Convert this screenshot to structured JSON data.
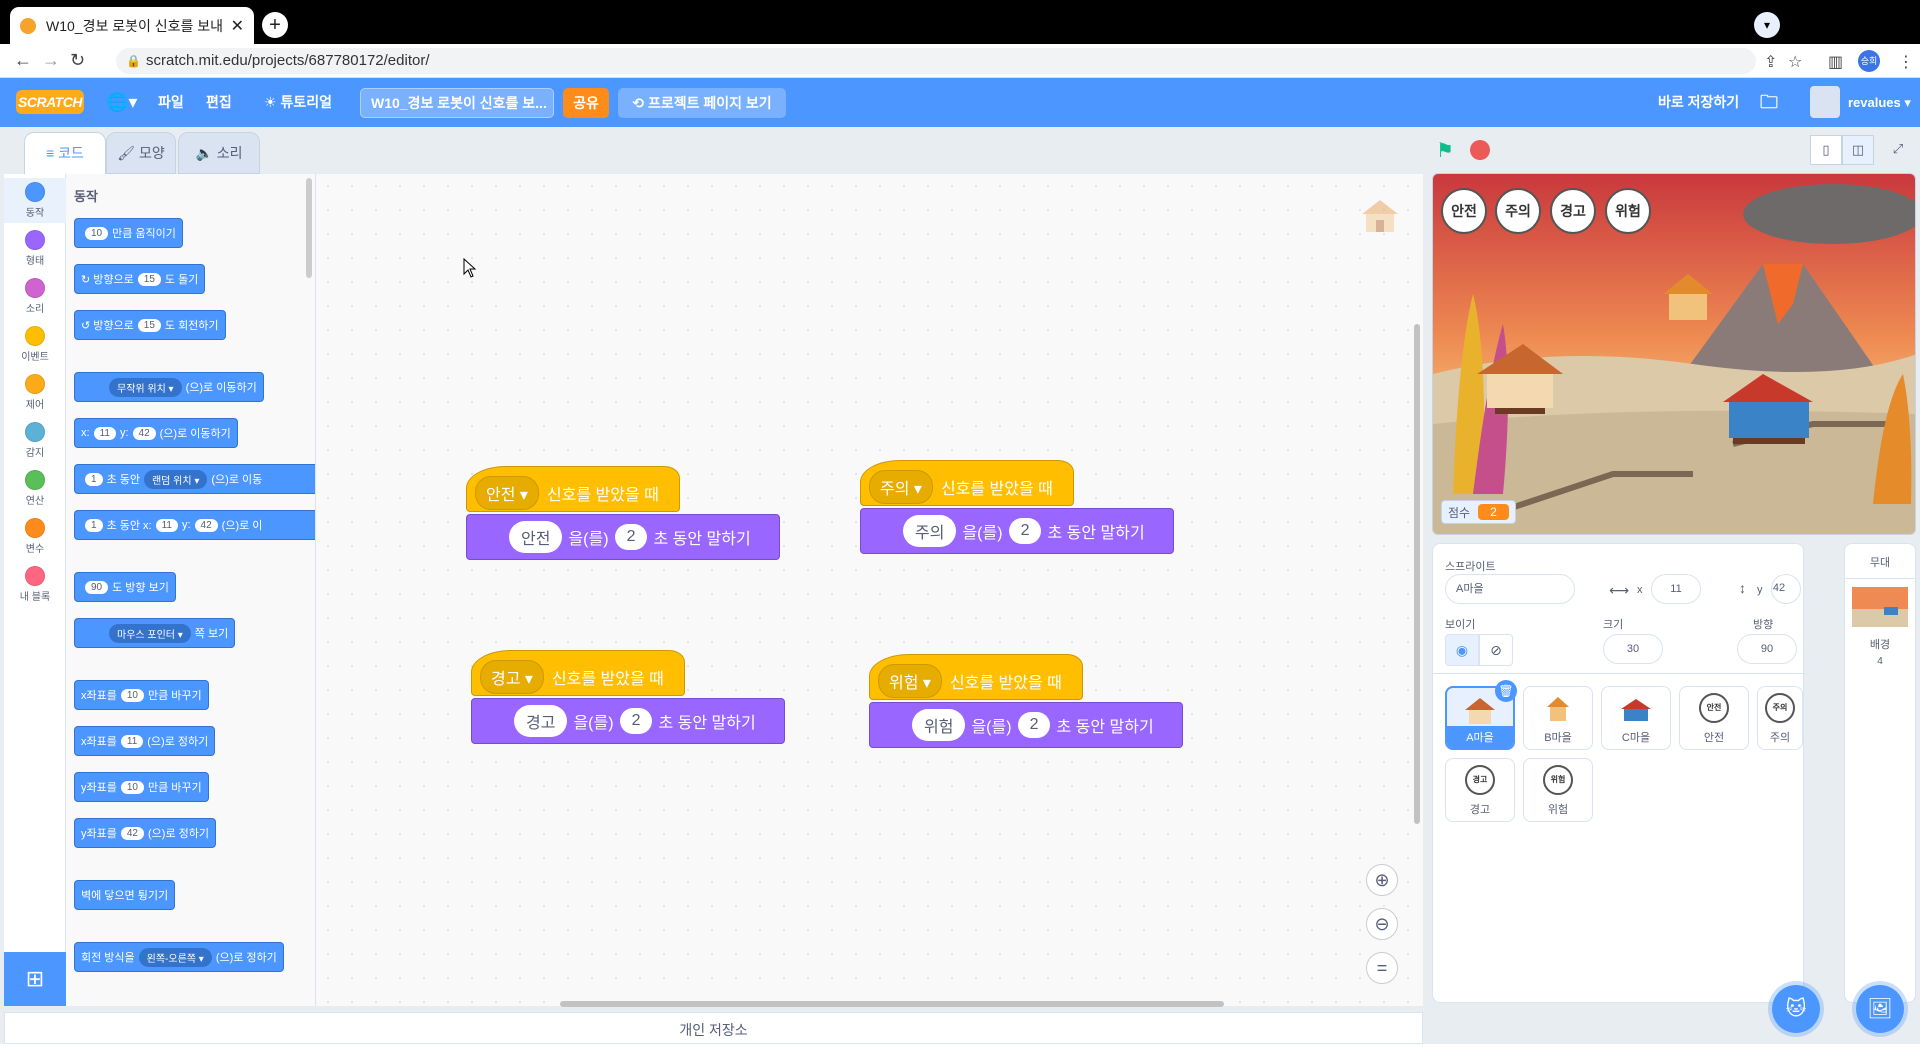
{
  "browser": {
    "tab_title": "W10_경보 로봇이 신호를 보내",
    "url": "scratch.mit.edu/projects/687780172/editor/",
    "avatar_initials": "승희"
  },
  "menu": {
    "logo": "SCRATCH",
    "file": "파일",
    "edit": "편집",
    "tutorials": "튜토리얼",
    "project_title": "W10_경보 로봇이 신호를 보...",
    "share": "공유",
    "see_project": "프로젝트 페이지 보기",
    "save_now": "바로 저장하기",
    "username": "revalues"
  },
  "editor_tabs": {
    "code": "코드",
    "costumes": "모양",
    "sounds": "소리"
  },
  "categories": [
    {
      "label": "동작",
      "color": "#4c97ff"
    },
    {
      "label": "형태",
      "color": "#9966ff"
    },
    {
      "label": "소리",
      "color": "#cf63cf"
    },
    {
      "label": "이벤트",
      "color": "#ffbf00"
    },
    {
      "label": "제어",
      "color": "#ffab19"
    },
    {
      "label": "감지",
      "color": "#5cb1d6"
    },
    {
      "label": "연산",
      "color": "#59c059"
    },
    {
      "label": "변수",
      "color": "#ff8c1a"
    },
    {
      "label": "내 블록",
      "color": "#ff6680"
    }
  ],
  "palette": {
    "title": "동작",
    "blocks": {
      "move": {
        "v": "10",
        "t": "만큼 움직이기"
      },
      "turn_right": {
        "a": "방향으로",
        "v": "15",
        "b": "도 돌기"
      },
      "turn_left": {
        "a": "방향으로",
        "v": "15",
        "b": "도 회전하기"
      },
      "goto_random": {
        "dd": "무작위 위치",
        "b": "(으)로 이동하기"
      },
      "goto_xy": {
        "x": "x:",
        "xv": "11",
        "y": "y:",
        "yv": "42",
        "b": "(으)로 이동하기"
      },
      "glide_random": {
        "v": "1",
        "a": "초 동안",
        "dd": "랜덤 위치",
        "b": "(으)로 이동"
      },
      "glide_xy": {
        "v": "1",
        "a": "초 동안 x:",
        "xv": "11",
        "y": "y:",
        "yv": "42",
        "b": "(으)로 이"
      },
      "point_dir": {
        "v": "90",
        "b": "도 방향 보기"
      },
      "point_towards": {
        "dd": "마우스 포인터",
        "b": "쪽 보기"
      },
      "change_x": {
        "a": "x좌표를",
        "v": "10",
        "b": "만큼 바꾸기"
      },
      "set_x": {
        "a": "x좌표를",
        "v": "11",
        "b": "(으)로 정하기"
      },
      "change_y": {
        "a": "y좌표를",
        "v": "10",
        "b": "만큼 바꾸기"
      },
      "set_y": {
        "a": "y좌표를",
        "v": "42",
        "b": "(으)로 정하기"
      },
      "bounce": {
        "t": "벽에 닿으면 튕기기"
      },
      "rotation_style": {
        "a": "회전 방식을",
        "dd": "왼쪽-오른쪽",
        "b": "(으)로 정하기"
      }
    }
  },
  "scripts": [
    {
      "hat_value": "안전",
      "hat_text": "신호를 받았을 때",
      "say_value": "안전",
      "say_mid": "을(를)",
      "say_secs": "2",
      "say_tail": "초 동안 말하기"
    },
    {
      "hat_value": "주의",
      "hat_text": "신호를 받았을 때",
      "say_value": "주의",
      "say_mid": "을(를)",
      "say_secs": "2",
      "say_tail": "초 동안 말하기"
    },
    {
      "hat_value": "경고",
      "hat_text": "신호를 받았을 때",
      "say_value": "경고",
      "say_mid": "을(를)",
      "say_secs": "2",
      "say_tail": "초 동안 말하기"
    },
    {
      "hat_value": "위험",
      "hat_text": "신호를 받았을 때",
      "say_value": "위험",
      "say_mid": "을(를)",
      "say_secs": "2",
      "say_tail": "초 동안 말하기"
    }
  ],
  "backpack": "개인 저장소",
  "stage": {
    "buttons": [
      "안전",
      "주의",
      "경고",
      "위험"
    ],
    "score_label": "점수",
    "score_value": "2"
  },
  "sprite_info": {
    "sprite_label": "스프라이트",
    "sprite_name": "A마을",
    "x_label": "x",
    "x": "11",
    "y_label": "y",
    "y": "42",
    "show_label": "보이기",
    "size_label": "크기",
    "size": "30",
    "direction_label": "방향",
    "direction": "90"
  },
  "sprites": [
    "A마을",
    "B마을",
    "C마을",
    "안전",
    "주의",
    "경고",
    "위험"
  ],
  "sprite_thumbs": [
    "안전",
    "주의",
    "경고",
    "위험"
  ],
  "stage_panel": {
    "title": "무대",
    "backdrops_label": "배경",
    "backdrop_count": "4"
  }
}
